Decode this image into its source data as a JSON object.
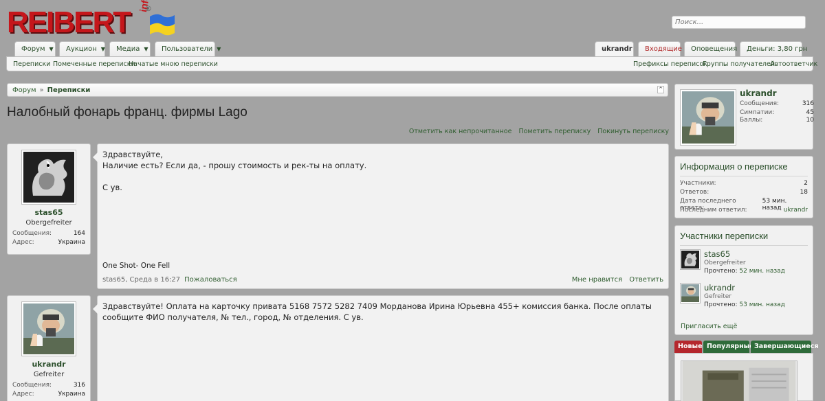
{
  "header": {
    "logo_text": "REIBERT",
    "logo_info": "info",
    "logo_reg": "®",
    "search_placeholder": "Поиск..."
  },
  "nav": {
    "left_tabs": [
      "Форум",
      "Аукцион",
      "Медиа",
      "Пользователи"
    ],
    "user_tab": "ukrandr",
    "inbox_tab": "Входящие",
    "alerts_tab": "Оповещения",
    "money_tab": "Деньги: 3,80 грн"
  },
  "subnav": {
    "left": [
      "Переписки",
      "Помеченные переписки",
      "Начатые мною переписки"
    ],
    "right": [
      "Префиксы переписок",
      "Группы получателей",
      "Автоответчик"
    ]
  },
  "breadcrumb": {
    "home": "Форум",
    "separator": "»",
    "current": "Переписки",
    "corner": "^"
  },
  "page_title": "Налобный фонарь франц. фирмы Lago",
  "title_actions": [
    "Отметить как непрочитанное",
    "Пометить переписку",
    "Покинуть переписку"
  ],
  "messages": [
    {
      "user": {
        "name": "stas65",
        "title": "Obergefreiter",
        "extra": [
          {
            "k": "Сообщения:",
            "v": "164"
          },
          {
            "k": "Адрес:",
            "v": "Украина"
          }
        ]
      },
      "lines": [
        "Здравствуйте,",
        "Наличие есть? Если да, - прошу стоимость и рек-ты на оплату.",
        "",
        "С ув."
      ],
      "signature": "One Shot- One Fell",
      "meta": "stas65, Среда в 16:27",
      "report": "Пожаловаться",
      "actions": [
        "Мне нравится",
        "Ответить"
      ]
    },
    {
      "user": {
        "name": "ukrandr",
        "title": "Gefreiter",
        "extra": [
          {
            "k": "Сообщения:",
            "v": "316"
          },
          {
            "k": "Адрес:",
            "v": "Украина"
          }
        ]
      },
      "lines": [
        "Здравствуйте! Оплата на карточку привата 5168 7572 5282 7409 Морданова Ирина Юрьевна 455+ комиссия банка. После оплаты сообщите ФИО получателя, № тел., город, № отделения. С ув."
      ]
    }
  ],
  "sidebar": {
    "profile": {
      "name": "ukrandr",
      "stats": [
        {
          "k": "Сообщения:",
          "v": "316"
        },
        {
          "k": "Симпатии:",
          "v": "45"
        },
        {
          "k": "Баллы:",
          "v": "10"
        }
      ]
    },
    "info": {
      "heading": "Информация о переписке",
      "rows": [
        {
          "k": "Участники:",
          "v": "2"
        },
        {
          "k": "Ответов:",
          "v": "18"
        },
        {
          "k": "Дата последнего ответа:",
          "v": "53 мин. назад"
        },
        {
          "k": "Последним ответил:",
          "v": "ukrandr"
        }
      ]
    },
    "participants": {
      "heading": "Участники переписки",
      "list": [
        {
          "name": "stas65",
          "title": "Obergefreiter",
          "read_label": "Прочтено:",
          "read_time": "52 мин. назад"
        },
        {
          "name": "ukrandr",
          "title": "Gefreiter",
          "read_label": "Прочтено:",
          "read_time": "53 мин. назад"
        }
      ],
      "invite": "Пригласить ещё"
    },
    "tabs": [
      "Новые",
      "Популярные",
      "Завершающиеся"
    ],
    "tab_colors": [
      "#b5272d",
      "#2e6b3a",
      "#2e6b3a"
    ]
  }
}
